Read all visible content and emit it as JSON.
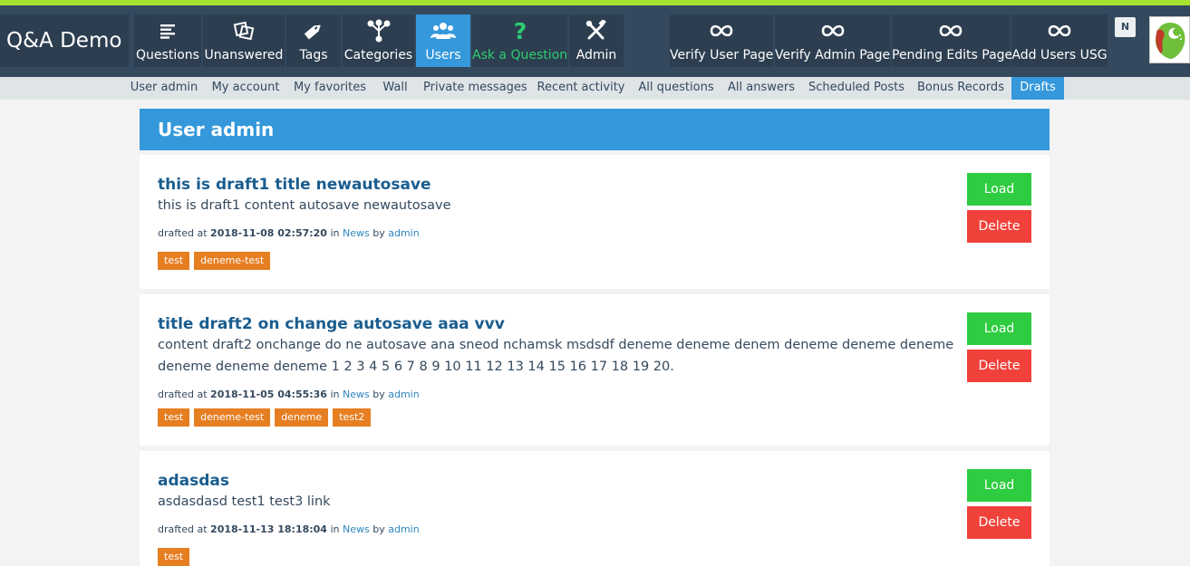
{
  "app": {
    "logo": "Q&A Demo"
  },
  "nav": {
    "questions": "Questions",
    "unanswered": "Unanswered",
    "tags": "Tags",
    "categories": "Categories",
    "users": "Users",
    "ask": "Ask a Question",
    "admin": "Admin",
    "verify_user": "Verify User Page",
    "verify_admin": "Verify Admin Page",
    "pending_edits": "Pending Edits Page",
    "add_users": "Add Users USG",
    "notification_badge": "N"
  },
  "subnav": {
    "items": [
      "User admin",
      "My account",
      "My favorites",
      "Wall",
      "Private messages",
      "Recent activity",
      "All questions",
      "All answers",
      "Scheduled Posts",
      "Bonus Records",
      "Drafts"
    ],
    "active": "Drafts"
  },
  "page": {
    "title": "User admin"
  },
  "drafts": [
    {
      "title": "this is draft1 title newautosave",
      "content": "this is draft1 content autosave newautosave",
      "meta_prefix": "drafted at",
      "date": "2018-11-08 02:57:20",
      "in_word": "in",
      "category": "News",
      "by_word": "by",
      "author": "admin",
      "tags": [
        "test",
        "deneme-test"
      ]
    },
    {
      "title": "title draft2 on change autosave aaa vvv",
      "content": "content draft2 onchange do ne autosave ana sneod nchamsk msdsdf deneme deneme denem deneme deneme deneme deneme deneme deneme 1 2 3 4 5 6 7 8 9 10 11 12 13 14 15 16 17 18 19 20.",
      "meta_prefix": "drafted at",
      "date": "2018-11-05 04:55:36",
      "in_word": "in",
      "category": "News",
      "by_word": "by",
      "author": "admin",
      "tags": [
        "test",
        "deneme-test",
        "deneme",
        "test2"
      ]
    },
    {
      "title": "adasdas",
      "content": "asdasdasd test1 test3 link",
      "meta_prefix": "drafted at",
      "date": "2018-11-13 18:18:04",
      "in_word": "in",
      "category": "News",
      "by_word": "by",
      "author": "admin",
      "tags": [
        "test"
      ]
    }
  ],
  "buttons": {
    "load": "Load",
    "delete": "Delete"
  },
  "colors": {
    "accent": "#3498db",
    "navbar": "#34495e",
    "load": "#2ecc40",
    "delete": "#f0413a",
    "tag": "#e67e22",
    "ask": "#2ecc71",
    "top_strip": "#a6e22e"
  },
  "icons": {
    "questions": "list-icon",
    "unanswered": "squares-icon",
    "tags": "tag-icon",
    "categories": "branch-icon",
    "users": "users-icon",
    "ask": "question-mark-icon",
    "admin": "tools-icon",
    "custom_pages": "infinity-icon"
  }
}
